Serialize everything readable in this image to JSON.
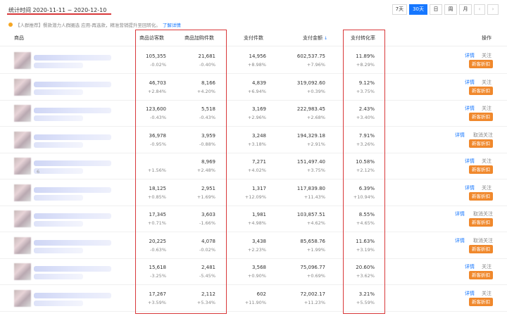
{
  "header": {
    "stat_range": "统计时间 2020-11-11 ~ 2020-12-10",
    "buttons": [
      "7天",
      "30天",
      "日",
      "周",
      "月"
    ],
    "nav_prev": "‹",
    "nav_next": "›"
  },
  "notice": {
    "text": "【人群推荐】餐款潜力人群圈选 应用-再选款，精准营销提升至回转化。",
    "link": "了解详情"
  },
  "columns": {
    "product": "商品",
    "visitors": "商品访客数",
    "cart": "商品加购件数",
    "pay_count": "支付件数",
    "pay_amount": "支付金额",
    "sort_icon": "↓",
    "conversion": "支付转化率",
    "action": "操作"
  },
  "actions": {
    "detail": "详情",
    "follow": "关注",
    "unfollow": "取消关注",
    "promo": "新客折扣"
  },
  "rows": [
    {
      "visitors": "105,355",
      "visitors_chg": "-0.02%",
      "cart": "21,681",
      "cart_chg": "-0.40%",
      "pay_count": "14,956",
      "pay_count_chg": "+8.98%",
      "pay_amount": "602,537.75",
      "pay_amount_chg": "+7.96%",
      "conversion": "11.89%",
      "conversion_chg": "+8.29%",
      "follow": "关注",
      "name_suffix": ""
    },
    {
      "visitors": "46,703",
      "visitors_chg": "+2.84%",
      "cart": "8,166",
      "cart_chg": "+4.20%",
      "pay_count": "4,839",
      "pay_count_chg": "+6.94%",
      "pay_amount": "319,092.60",
      "pay_amount_chg": "+0.39%",
      "conversion": "9.12%",
      "conversion_chg": "+3.75%",
      "follow": "关注",
      "name_suffix": ""
    },
    {
      "visitors": "123,600",
      "visitors_chg": "-0.43%",
      "cart": "5,518",
      "cart_chg": "-0.43%",
      "pay_count": "3,169",
      "pay_count_chg": "+2.96%",
      "pay_amount": "222,983.45",
      "pay_amount_chg": "+2.68%",
      "conversion": "2.43%",
      "conversion_chg": "+3.40%",
      "follow": "关注",
      "name_suffix": ""
    },
    {
      "visitors": "36,978",
      "visitors_chg": "-0.95%",
      "cart": "3,959",
      "cart_chg": "-0.88%",
      "pay_count": "3,248",
      "pay_count_chg": "+3.18%",
      "pay_amount": "194,329.18",
      "pay_amount_chg": "+2.91%",
      "conversion": "7.91%",
      "conversion_chg": "+3.26%",
      "follow": "取消关注",
      "name_suffix": ""
    },
    {
      "visitors": "",
      "visitors_chg": "+1.56%",
      "cart": "8,969",
      "cart_chg": "+2.48%",
      "pay_count": "7,271",
      "pay_count_chg": "+4.02%",
      "pay_amount": "151,497.40",
      "pay_amount_chg": "+3.75%",
      "conversion": "10.58%",
      "conversion_chg": "+2.12%",
      "follow": "关注",
      "name_suffix": "6"
    },
    {
      "visitors": "18,125",
      "visitors_chg": "+0.85%",
      "cart": "2,951",
      "cart_chg": "+1.69%",
      "pay_count": "1,317",
      "pay_count_chg": "+12.09%",
      "pay_amount": "117,839.80",
      "pay_amount_chg": "+11.43%",
      "conversion": "6.39%",
      "conversion_chg": "+10.94%",
      "follow": "关注",
      "name_suffix": ""
    },
    {
      "visitors": "17,345",
      "visitors_chg": "+0.71%",
      "cart": "3,603",
      "cart_chg": "-1.66%",
      "pay_count": "1,981",
      "pay_count_chg": "+4.98%",
      "pay_amount": "103,857.51",
      "pay_amount_chg": "+4.62%",
      "conversion": "8.55%",
      "conversion_chg": "+4.65%",
      "follow": "取消关注",
      "name_suffix": ""
    },
    {
      "visitors": "20,225",
      "visitors_chg": "-0.63%",
      "cart": "4,078",
      "cart_chg": "-0.02%",
      "pay_count": "3,438",
      "pay_count_chg": "+2.23%",
      "pay_amount": "85,658.76",
      "pay_amount_chg": "+1.99%",
      "conversion": "11.63%",
      "conversion_chg": "+3.19%",
      "follow": "取消关注",
      "name_suffix": ""
    },
    {
      "visitors": "15,618",
      "visitors_chg": "-3.25%",
      "cart": "2,481",
      "cart_chg": "-5.45%",
      "pay_count": "3,568",
      "pay_count_chg": "+0.90%",
      "pay_amount": "75,096.77",
      "pay_amount_chg": "+0.69%",
      "conversion": "20.60%",
      "conversion_chg": "+3.62%",
      "follow": "关注",
      "name_suffix": ""
    },
    {
      "visitors": "17,267",
      "visitors_chg": "+3.59%",
      "cart": "2,112",
      "cart_chg": "+5.34%",
      "pay_count": "602",
      "pay_count_chg": "+11.90%",
      "pay_amount": "72,002.17",
      "pay_amount_chg": "+11.23%",
      "conversion": "3.21%",
      "conversion_chg": "+5.59%",
      "follow": "关注",
      "name_suffix": ""
    }
  ],
  "colors": {
    "accent": "#1677ff",
    "highlight_box": "#d9383a",
    "promo_button": "#f0882c"
  }
}
